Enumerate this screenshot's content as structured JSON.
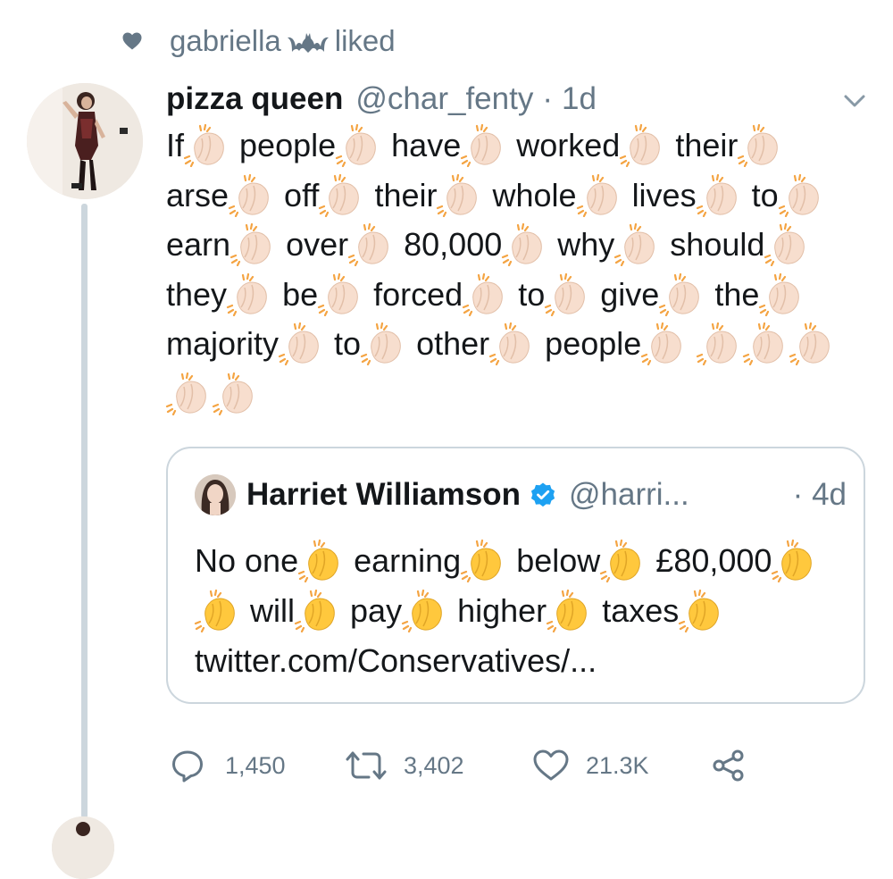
{
  "social_context": {
    "user": "gabriella",
    "verb": "liked",
    "heart_icon": "heart-icon",
    "emoji_icon": "bat-icon"
  },
  "tweet": {
    "display_name": "pizza queen",
    "handle": "@char_fenty",
    "separator": "·",
    "time": "1d",
    "menu_icon": "chevron-down-icon",
    "words": [
      "If",
      "people",
      "have",
      "worked",
      "their",
      "arse",
      "off",
      "their",
      "whole",
      "lives",
      "to",
      "earn",
      "over",
      "80,000",
      "why",
      "should",
      "they",
      "be",
      "forced",
      "to",
      "give",
      "the",
      "majority",
      "to",
      "other",
      "people"
    ],
    "trailing_emoji_count": 6,
    "emoji_icon": "clapping-hands-icon",
    "emoji_tone": "light"
  },
  "quoted_tweet": {
    "display_name": "Harriet Williamson",
    "verified_icon": "verified-badge-icon",
    "handle": "@harri...",
    "separator": "·",
    "time": "4d",
    "words": [
      "No one",
      "earning",
      "below",
      "£80,000",
      "",
      "will",
      "pay",
      "higher",
      "taxes"
    ],
    "link": "twitter.com/Conservatives/...",
    "emoji_icon": "clapping-hands-icon",
    "emoji_tone": "yellow"
  },
  "actions": {
    "replies": "1,450",
    "retweets": "3,402",
    "likes": "21.3K",
    "icons": [
      "reply-icon",
      "retweet-icon",
      "like-icon",
      "share-icon"
    ]
  },
  "colors": {
    "text": "#14171a",
    "secondary": "#657786",
    "border": "#ccd6dd",
    "verified": "#1da1f2",
    "clap_light": "#f7dece",
    "clap_yellow": "#ffc83d",
    "clap_sparkle": "#f4a443"
  }
}
